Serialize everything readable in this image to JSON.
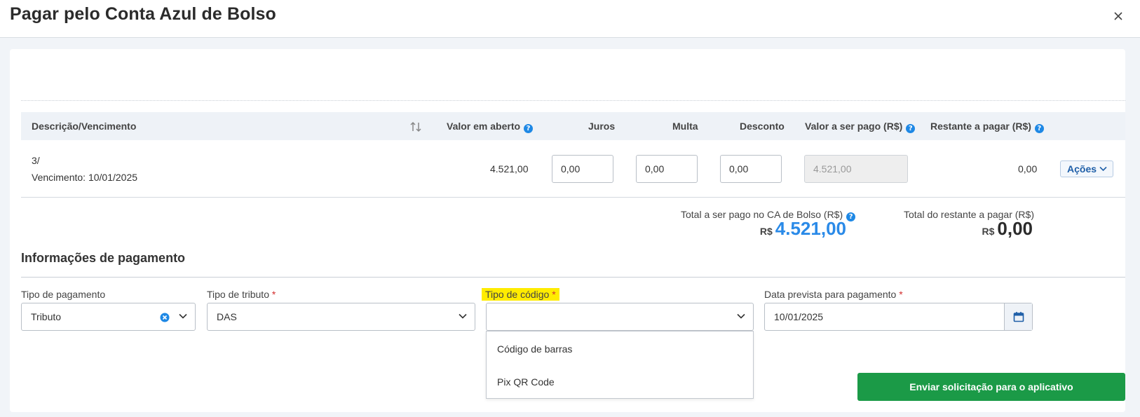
{
  "modal": {
    "title": "Pagar pelo Conta Azul de Bolso"
  },
  "table": {
    "headers": {
      "descricao": "Descrição/Vencimento",
      "valor_aberto": "Valor em aberto",
      "juros": "Juros",
      "multa": "Multa",
      "desconto": "Desconto",
      "valor_pago": "Valor a ser pago (R$)",
      "restante": "Restante a pagar (R$)"
    },
    "help_glyph": "?",
    "row": {
      "descricao": "3/",
      "vencimento_label": "Vencimento:",
      "vencimento_data": "10/01/2025",
      "valor_aberto": "4.521,00",
      "juros": "0,00",
      "multa": "0,00",
      "desconto": "0,00",
      "valor_pago": "4.521,00",
      "restante": "0,00",
      "acoes_label": "Ações"
    }
  },
  "totals": {
    "pago_label": "Total a ser pago no CA de Bolso (R$)",
    "pago_currency": "R$",
    "pago_value": "4.521,00",
    "restante_label": "Total do restante a pagar (R$)",
    "restante_currency": "R$",
    "restante_value": "0,00"
  },
  "payment": {
    "section_title": "Informações de pagamento",
    "required_mark": "*",
    "tipo_pagamento": {
      "label": "Tipo de pagamento",
      "value": "Tributo"
    },
    "tipo_tributo": {
      "label": "Tipo de tributo",
      "value": "DAS"
    },
    "tipo_codigo": {
      "label": "Tipo de código",
      "value": "",
      "options": [
        "Código de barras",
        "Pix QR Code"
      ]
    },
    "data_prevista": {
      "label": "Data prevista para pagamento",
      "value": "10/01/2025"
    }
  },
  "submit_label": "Enviar solicitação para o aplicativo",
  "icons": {
    "close": "close-icon",
    "help": "help-icon",
    "sort": "sort-icon",
    "chevron": "chevron-down-icon",
    "clear": "clear-icon",
    "calendar": "calendar-icon"
  },
  "colors": {
    "accent_blue": "#1e88e5",
    "total_blue": "#2a8ae8",
    "success_green": "#1b9a47",
    "highlight_yellow": "#ffec00",
    "required_red": "#d32f2f"
  }
}
